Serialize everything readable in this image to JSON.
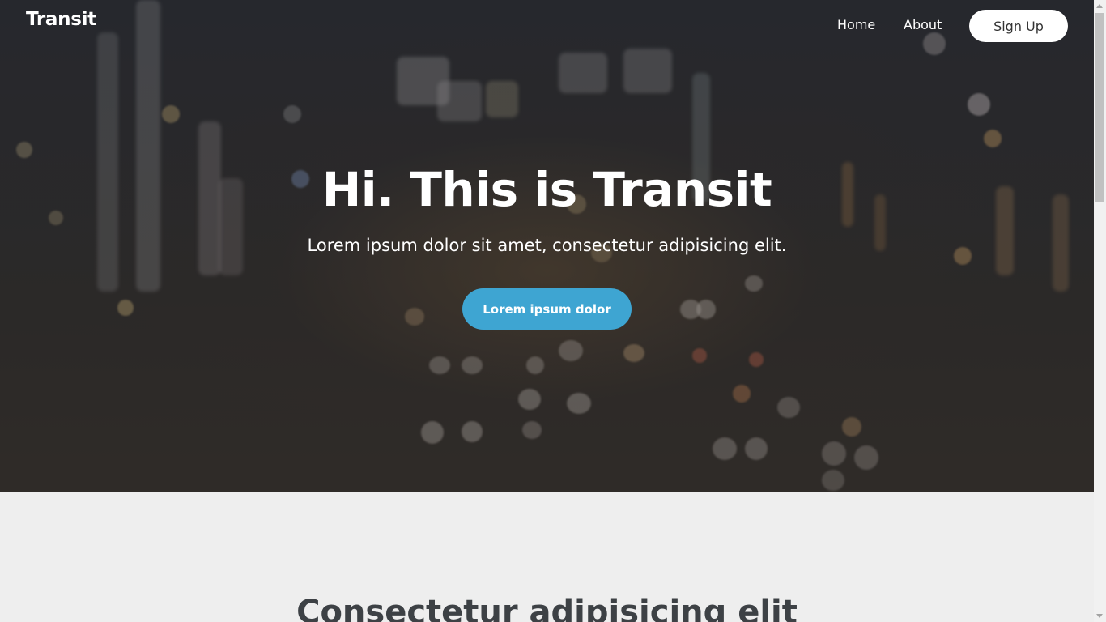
{
  "header": {
    "brand": "Transit",
    "nav": {
      "home": "Home",
      "about": "About",
      "signup": "Sign Up"
    }
  },
  "hero": {
    "title": "Hi. This is Transit",
    "subtitle": "Lorem ipsum dolor sit amet, consectetur adipisicing elit.",
    "cta_label": "Lorem ipsum dolor",
    "background_icon": "city-bokeh-night-image"
  },
  "section": {
    "heading": "Consectetur adipisicing elit"
  },
  "colors": {
    "accent": "#3ea5d2",
    "page_background": "#eeeeee",
    "hero_overlay": "#2e3033",
    "heading_text": "#3d4145"
  }
}
